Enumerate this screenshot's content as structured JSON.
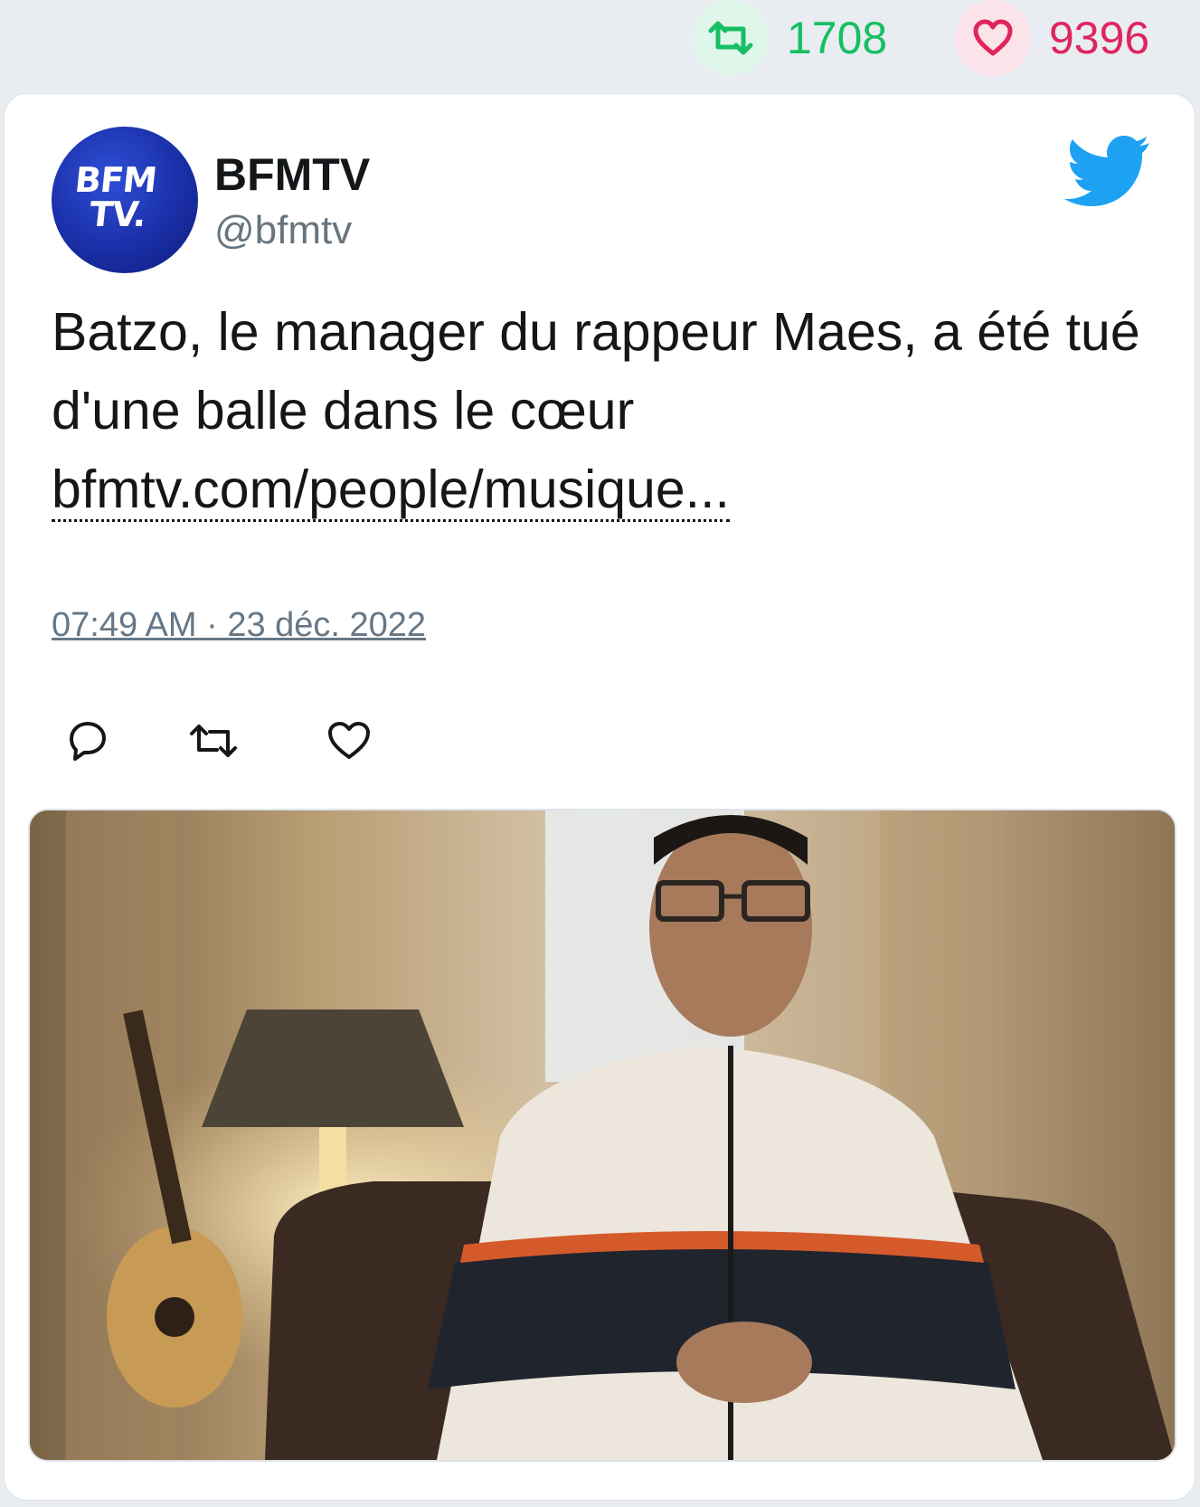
{
  "stats": {
    "retweets": "1708",
    "likes": "9396",
    "retweet_icon": "retweet-icon",
    "like_icon": "heart-icon",
    "retweet_color": "#17bf63",
    "like_color": "#e0245e"
  },
  "tweet": {
    "author_name": "BFMTV",
    "author_handle": "@bfmtv",
    "avatar_text": {
      "line1": "BFM",
      "line2": "TV."
    },
    "text": "Batzo, le manager du rappeur Maes, a été tué d'une balle dans le cœur",
    "link": "bfmtv.com/people/musique...",
    "timestamp": "07:49 AM · 23 déc. 2022",
    "brand_color": "#1da1f2",
    "actions": [
      "reply-icon",
      "retweet-icon",
      "like-icon"
    ]
  }
}
